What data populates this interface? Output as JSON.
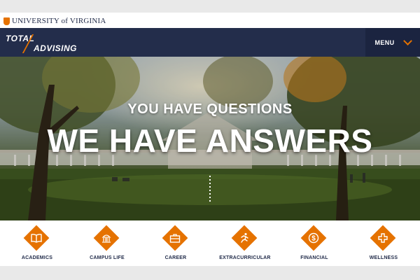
{
  "header": {
    "university_name": "UNIVERSITY of VIRGINIA",
    "brand_line1": "TOTAL",
    "brand_line2": "ADVISING",
    "menu_label": "MENU"
  },
  "hero": {
    "subtitle": "YOU HAVE QUESTIONS",
    "title": "WE HAVE ANSWERS"
  },
  "categories": [
    {
      "label": "ACADEMICS",
      "icon": "book-icon"
    },
    {
      "label": "CAMPUS LIFE",
      "icon": "rotunda-icon"
    },
    {
      "label": "CAREER",
      "icon": "briefcase-icon"
    },
    {
      "label": "EXTRACURRICULAR",
      "icon": "runner-icon"
    },
    {
      "label": "FINANCIAL",
      "icon": "dollar-coin-icon"
    },
    {
      "label": "WELLNESS",
      "icon": "plus-icon"
    }
  ],
  "colors": {
    "navy": "#232d4b",
    "orange": "#e57200"
  }
}
